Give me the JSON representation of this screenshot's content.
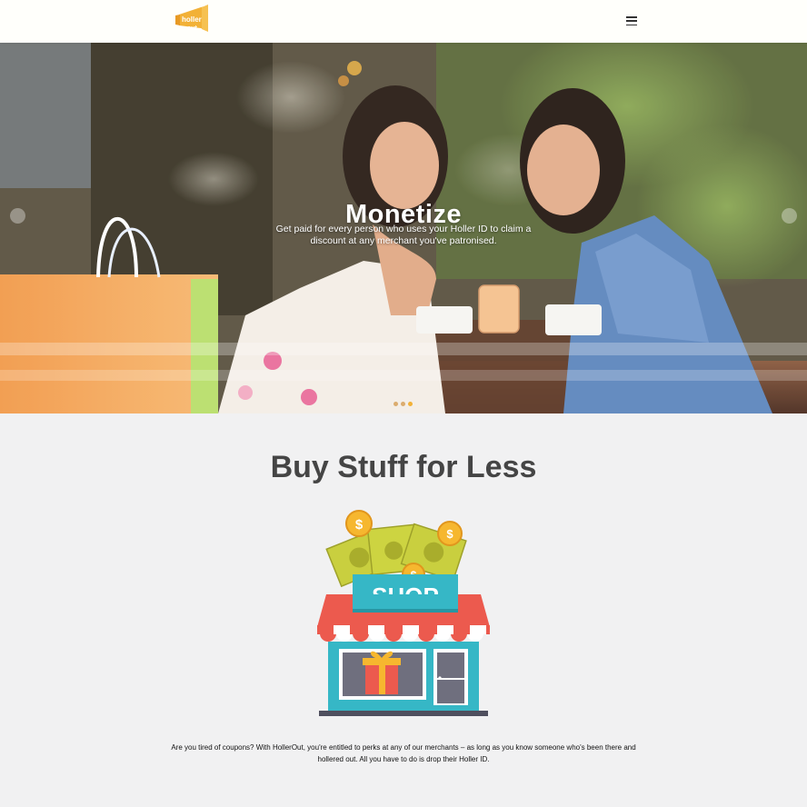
{
  "header": {
    "logo_text": "holler out",
    "menu_icon": "hamburger-menu-icon"
  },
  "hero": {
    "title": "Monetize",
    "text": "Get paid for every person who uses your Holler ID to claim a discount at any merchant you've patronised.",
    "slides_total": 3,
    "active_slide": 3,
    "prev_icon": "arrow-left-icon",
    "next_icon": "arrow-right-icon"
  },
  "main": {
    "title": "Buy Stuff for Less",
    "shop_sign": "SHOP",
    "intro": "Are you tired of coupons? With HollerOut, you're entitled to perks at any of our merchants – as long as you know someone who's been there and hollered out. All you have to do is drop their Holler ID."
  },
  "colors": {
    "brand": "#f2b137",
    "heading": "#454545",
    "page_bg": "#f1f1f2",
    "header_bg": "#fffffb"
  }
}
